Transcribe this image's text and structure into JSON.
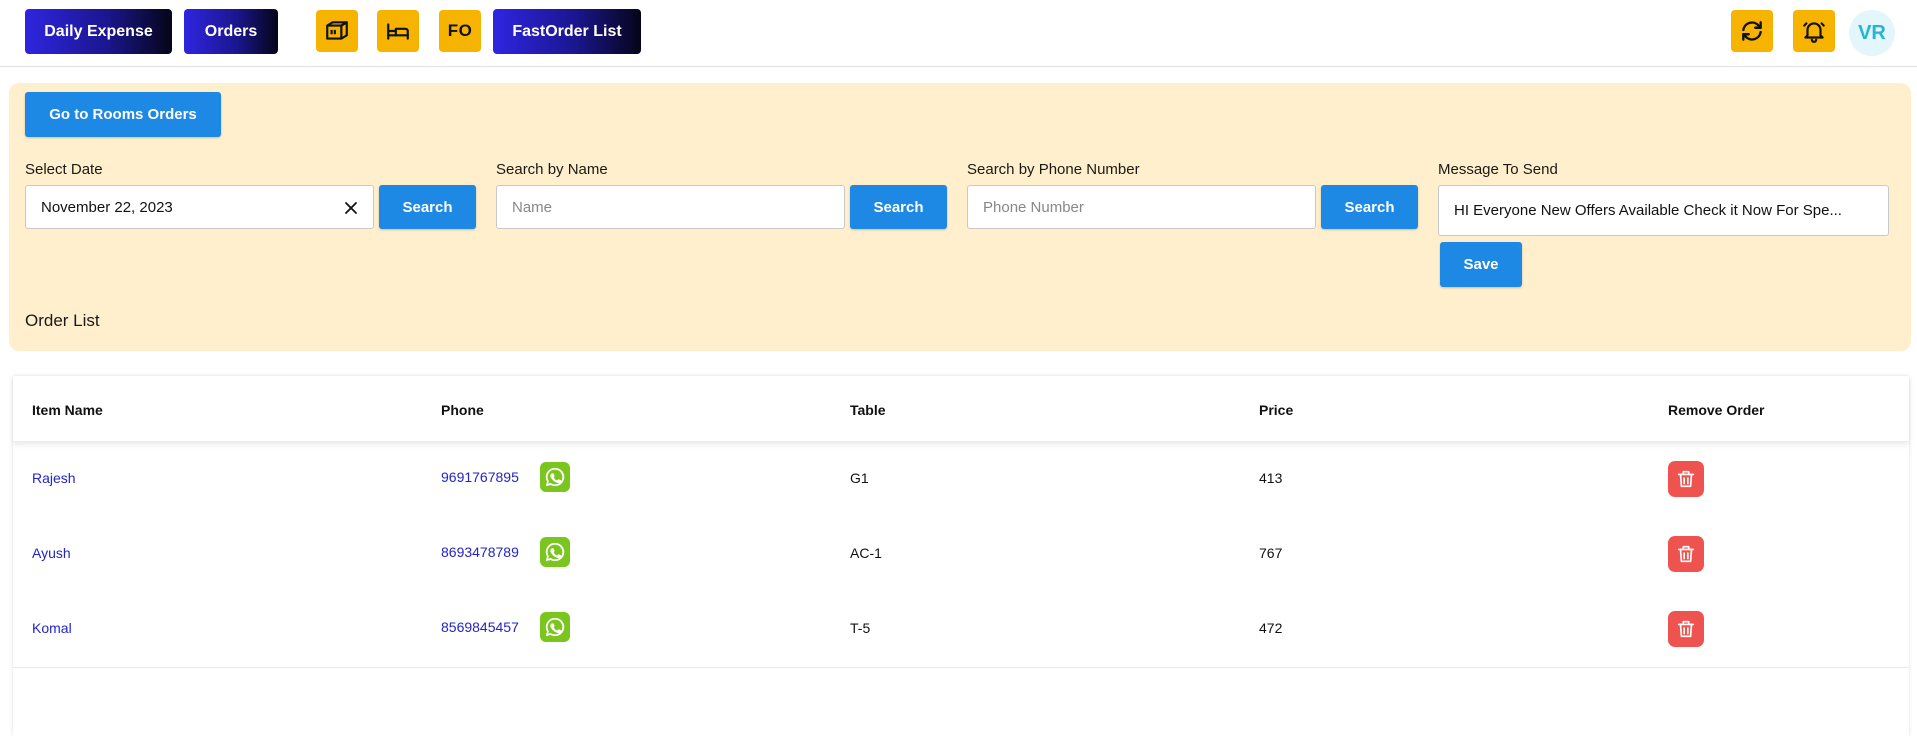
{
  "nav": {
    "daily_expense": "Daily Expense",
    "orders": "Orders",
    "fo_label": "FO",
    "fastorder_list": "FastOrder List",
    "icons": [
      "package-icon",
      "bed-icon",
      "fo-icon",
      "refresh-icon",
      "bell-icon"
    ],
    "avatar_initials": "VR"
  },
  "panel": {
    "rooms_button": "Go to Rooms Orders",
    "date": {
      "label": "Select Date",
      "value": "November 22, 2023",
      "search": "Search"
    },
    "name": {
      "label": "Search by Name",
      "placeholder": "Name",
      "search": "Search"
    },
    "phone": {
      "label": "Search by Phone Number",
      "placeholder": "Phone Number",
      "search": "Search"
    },
    "message": {
      "label": "Message To Send",
      "value": "HI Everyone New Offers Available Check it Now For Spe...",
      "save": "Save"
    },
    "order_list_title": "Order List"
  },
  "table": {
    "headers": [
      "Item Name",
      "Phone",
      "Table",
      "Price",
      "Remove Order"
    ],
    "rows": [
      {
        "name": "Rajesh",
        "phone": "9691767895",
        "table": "G1",
        "price": "413"
      },
      {
        "name": "Ayush",
        "phone": "8693478789",
        "table": "AC-1",
        "price": "767"
      },
      {
        "name": "Komal",
        "phone": "8569845457",
        "table": "T-5",
        "price": "472"
      }
    ]
  },
  "colors": {
    "accent_blue": "#1e88e5",
    "icon_yellow": "#f6b400",
    "panel_bg": "#ffefcc",
    "delete_red": "#ef5350",
    "whatsapp_green": "#7bc51f",
    "link_blue": "#2424c8"
  }
}
